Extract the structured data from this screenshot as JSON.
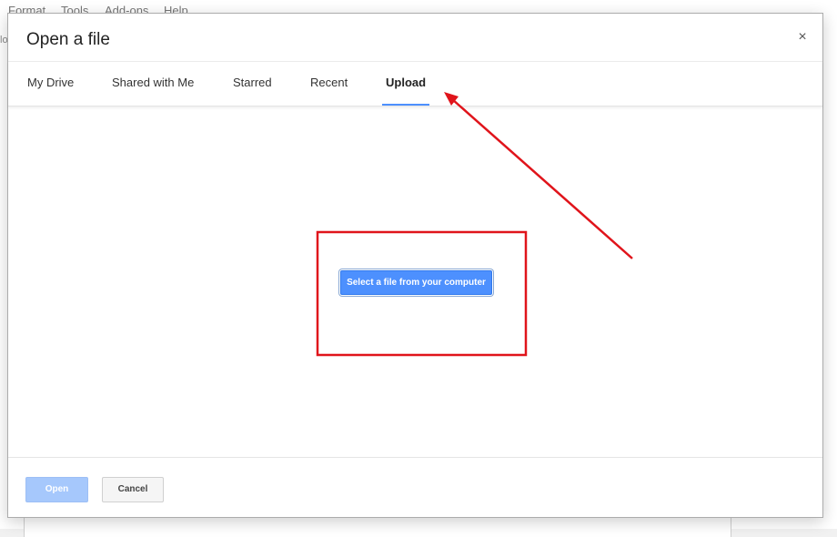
{
  "background": {
    "menu_items": [
      "Format",
      "Tools",
      "Add-ons",
      "Help"
    ],
    "edge_text": "lo"
  },
  "dialog": {
    "title": "Open a file",
    "close_symbol": "×",
    "tabs": [
      {
        "label": "My Drive",
        "active": false
      },
      {
        "label": "Shared with Me",
        "active": false
      },
      {
        "label": "Starred",
        "active": false
      },
      {
        "label": "Recent",
        "active": false
      },
      {
        "label": "Upload",
        "active": true
      }
    ],
    "upload": {
      "select_button_label": "Select a file from your computer"
    },
    "footer": {
      "open_label": "Open",
      "open_enabled": false,
      "cancel_label": "Cancel"
    }
  },
  "colors": {
    "accent": "#4d90fe",
    "annotation": "#e0141b",
    "open_disabled": "#a6c8fc"
  }
}
